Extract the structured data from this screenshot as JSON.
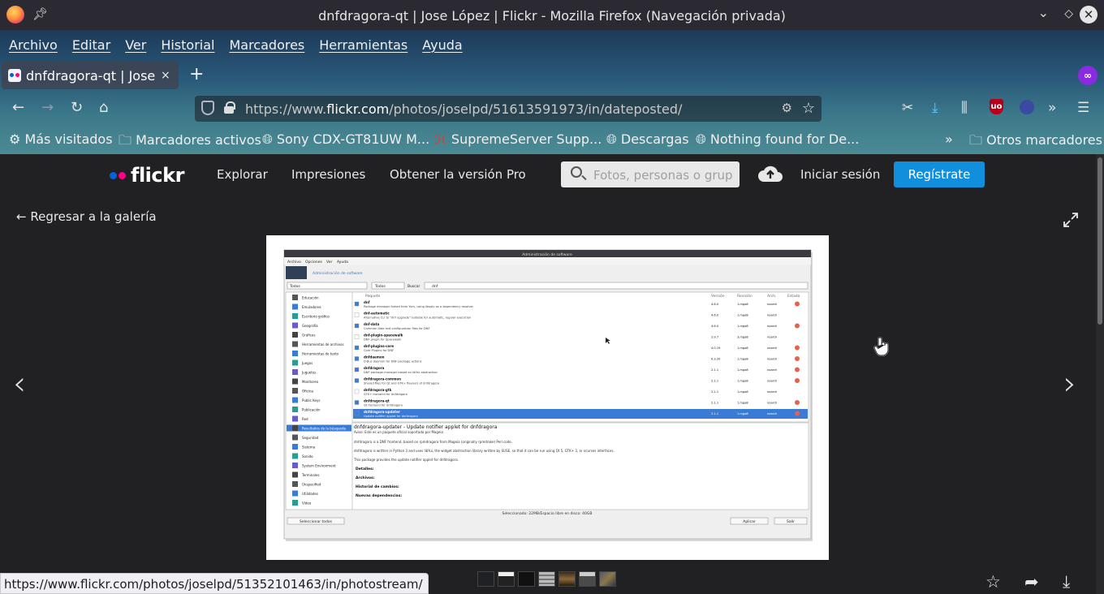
{
  "window": {
    "title": "dnfdragora-qt | Jose López | Flickr - Mozilla Firefox (Navegación privada)"
  },
  "menubar": [
    "Archivo",
    "Editar",
    "Ver",
    "Historial",
    "Marcadores",
    "Herramientas",
    "Ayuda"
  ],
  "tab": {
    "label": "dnfdragora-qt | Jose L",
    "close": "×",
    "new": "+"
  },
  "urlbar": {
    "prefix": "https://www.",
    "domain": "flickr.com",
    "path": "/photos/joselpd/51613591973/in/dateposted/"
  },
  "bookmarks": [
    {
      "icon": "gear-icon",
      "label": "Más visitados"
    },
    {
      "icon": "folder-icon",
      "label": "Marcadores activos"
    },
    {
      "icon": "globe-icon",
      "label": "Sony CDX-GT81UW M..."
    },
    {
      "icon": "supremeserver-icon",
      "label": "SupremeServer Supp..."
    },
    {
      "icon": "globe-icon",
      "label": "Descargas"
    },
    {
      "icon": "globe-icon",
      "label": "Nothing found for De..."
    }
  ],
  "bookmarks_other": "Otros marcadores",
  "flickr": {
    "logo": "flickr",
    "nav": [
      "Explorar",
      "Impresiones",
      "Obtener la versión Pro"
    ],
    "search_placeholder": "Fotos, personas o grupos",
    "login": "Iniciar sesión",
    "signup": "Regístrate"
  },
  "viewer": {
    "back": "Regresar a la galería"
  },
  "photo": {
    "window_title": "Administración de software",
    "menu": [
      "Archivo",
      "Opciones",
      "Ver",
      "Ayuda"
    ],
    "header": "Administración de software",
    "filter1": "Todos",
    "filter2": "Todos",
    "search_label": "Buscar",
    "search_value": "dnf",
    "columns": [
      "Paquete",
      "Versión",
      "Revisión",
      "Arch.",
      "Estado"
    ],
    "categories": [
      "Educación",
      "Emuladores",
      "Escritorio gráfico",
      "Geografía",
      "Gráficos",
      "Herramientas de archivos",
      "Herramientas de texto",
      "Juegos",
      "Juguetes",
      "Monitoreo",
      "Oficina",
      "Public Keys",
      "Publicación",
      "Red",
      "Resultados de la búsqueda",
      "Seguridad",
      "Sistema",
      "Sonido",
      "System Environment",
      "Terminales",
      "Unspecified",
      "Utilidades",
      "Vídeo"
    ],
    "packages": [
      {
        "name": "dnf",
        "desc": "Package manager forked from Yum, using libsolv as a dependency resolver",
        "ver": "4.6.0",
        "rev": "1.mga8",
        "arch": "noarch"
      },
      {
        "name": "dnf-automatic",
        "desc": "Alternative CLI to \"dnf upgrade\" suitable for automatic, regular execution",
        "ver": "4.6.0",
        "rev": "1.mga8",
        "arch": "noarch"
      },
      {
        "name": "dnf-data",
        "desc": "Common data and configuration files for DNF",
        "ver": "4.6.0",
        "rev": "1.mga8",
        "arch": "noarch"
      },
      {
        "name": "dnf-plugin-spacewalk",
        "desc": "DNF plugin for Spacewalk",
        "ver": "2.9.7",
        "rev": "3.mga8",
        "arch": "noarch"
      },
      {
        "name": "dnf-plugins-core",
        "desc": "Core Plugins for DNF",
        "ver": "4.0.19",
        "rev": "1.mga8",
        "arch": "noarch"
      },
      {
        "name": "dnfdaemon",
        "desc": "D-Bus daemon for DNF package actions",
        "ver": "0.3.20",
        "rev": "1.mga8",
        "arch": "noarch"
      },
      {
        "name": "dnfdragora",
        "desc": "DNF package-manager based on libYui abstraction",
        "ver": "2.1.1",
        "rev": "1.mga8",
        "arch": "noarch"
      },
      {
        "name": "dnfdragora-common",
        "desc": "Shared files for Qt and GTK+ flavours of dnfdragora",
        "ver": "2.1.1",
        "rev": "1.mga8",
        "arch": "noarch"
      },
      {
        "name": "dnfdragora-gtk",
        "desc": "GTK+ frontend for dnfdragora",
        "ver": "2.1.1",
        "rev": "1.mga8",
        "arch": "noarch"
      },
      {
        "name": "dnfdragora-qt",
        "desc": "Qt frontend for dnfdragora",
        "ver": "2.1.1",
        "rev": "1.mga8",
        "arch": "noarch"
      },
      {
        "name": "dnfdragora-updater",
        "desc": "Update notifier applet for dnfdragora",
        "ver": "2.1.1",
        "rev": "1.mga8",
        "arch": "noarch"
      }
    ],
    "detail_title": "dnfdragora-updater - Update notifier applet for dnfdragora",
    "detail_note": "Aviso: Este es un paquete oficial soportado por Mageia",
    "detail_p1": "dnfdragora is a DNF frontend, based on rpmdragora from Mageia (originally rpmdrake) Perl code.",
    "detail_p2": "dnfdragora is written in Python 3 and uses libYui, the widget abstraction library written by SUSE, so that it can be run using Qt 5, GTK+ 3, or ncurses interfaces.",
    "detail_p3": "This package provides the update notifier applet for dnfdragora.",
    "sections": [
      "Detalles:",
      "Archivos:",
      "Historial de cambios:",
      "Nuevas dependencias:"
    ],
    "status": "Seleccionado: 22MB/Espacio libre en disco: 40GB",
    "btn_select_all": "Seleccionar todos",
    "btn_apply": "Aplicar",
    "btn_quit": "Salir"
  },
  "statusbar": {
    "url": "https://www.flickr.com/photos/joselpd/51352101463/in/photostream/"
  }
}
